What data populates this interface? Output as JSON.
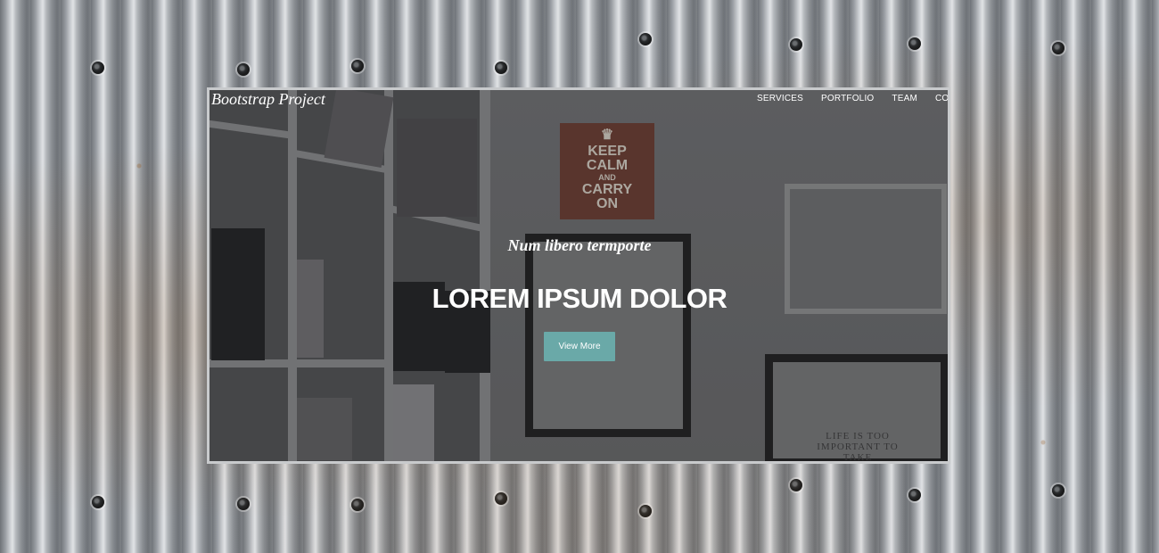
{
  "navbar": {
    "brand": "Bootstrap Project",
    "links": [
      {
        "label": "SERVICES"
      },
      {
        "label": "PORTFOLIO"
      },
      {
        "label": "TEAM"
      },
      {
        "label": "CONTACT"
      }
    ]
  },
  "hero": {
    "subtitle": "Num libero termporte",
    "title": "LOREM IPSUM DOLOR",
    "button_label": "View More"
  },
  "decor": {
    "poster_lines": [
      "KEEP",
      "CALM",
      "AND",
      "CARRY",
      "ON"
    ],
    "frame_caption": "LIFE IS TOO IMPORTANT TO TAKE"
  },
  "colors": {
    "accent": "#6aa9a8",
    "text": "#ffffff"
  }
}
